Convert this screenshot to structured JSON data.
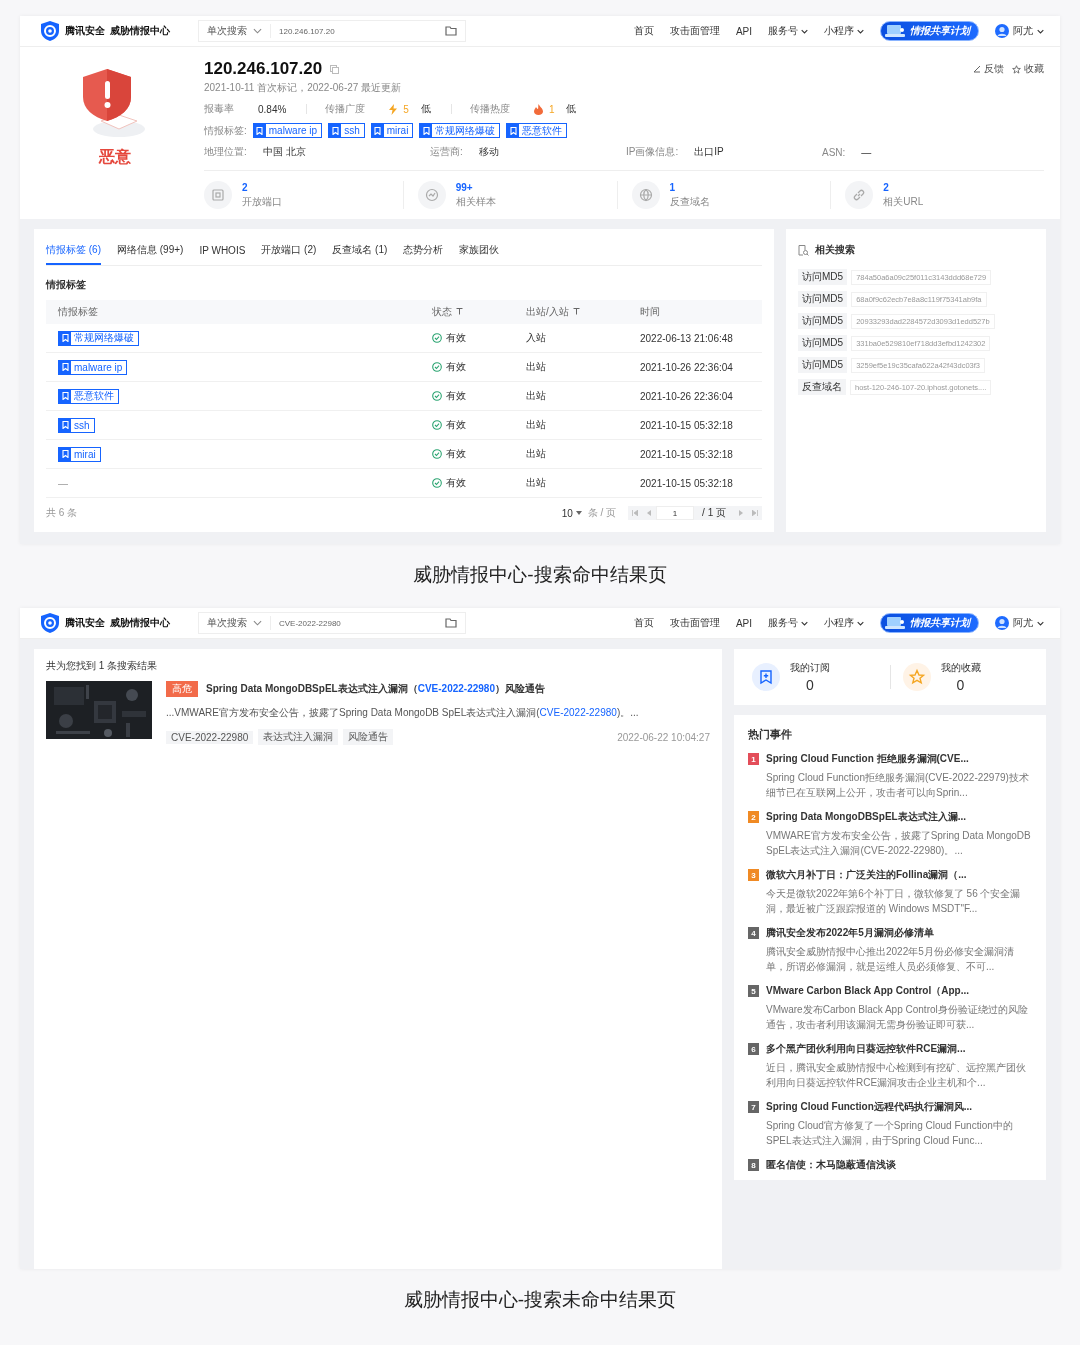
{
  "hit_page": {
    "header": {
      "brand": "腾讯安全",
      "product": "威胁情报中心",
      "search_mode": "单次搜索",
      "search_value": "120.246.107.20",
      "nav": [
        {
          "label": "首页",
          "has_menu": false
        },
        {
          "label": "攻击面管理",
          "has_menu": false
        },
        {
          "label": "API",
          "has_menu": false
        },
        {
          "label": "服务号",
          "has_menu": true
        },
        {
          "label": "小程序",
          "has_menu": true
        }
      ],
      "share_button": "情报共享计划",
      "user": "阿尤"
    },
    "verdict": "恶意",
    "ip": "120.246.107.20",
    "dates": "2021-10-11 首次标记，2022-06-27 最近更新",
    "actions": [
      {
        "label": "反馈",
        "kind": "edit"
      },
      {
        "label": "收藏",
        "kind": "star"
      }
    ],
    "stats": [
      {
        "label": "报毒率",
        "value": "0.84%",
        "kind": "plain"
      },
      {
        "label": "传播广度",
        "value": "5",
        "grade": "低",
        "kind": "bolt"
      },
      {
        "label": "传播热度",
        "value": "1",
        "grade": "低",
        "kind": "flame"
      }
    ],
    "tags_label": "情报标签:",
    "tags": [
      "malware ip",
      "ssh",
      "mirai",
      "常规网络爆破",
      "恶意软件"
    ],
    "info": [
      {
        "label": "地理位置:",
        "value": "中国 北京"
      },
      {
        "label": "运营商:",
        "value": "移动"
      },
      {
        "label": "IP画像信息:",
        "value": "出口IP"
      },
      {
        "label": "ASN:",
        "value": "—"
      }
    ],
    "counters": [
      {
        "value": "2",
        "label": "开放端口",
        "kind": "port"
      },
      {
        "value": "99+",
        "label": "相关样本",
        "kind": "sample"
      },
      {
        "value": "1",
        "label": "反查域名",
        "kind": "globe"
      },
      {
        "value": "2",
        "label": "相关URL",
        "kind": "link"
      }
    ],
    "tabs": [
      {
        "label": "情报标签 (6)",
        "selected": true
      },
      {
        "label": "网络信息 (99+)",
        "selected": false
      },
      {
        "label": "IP WHOIS",
        "selected": false
      },
      {
        "label": "开放端口 (2)",
        "selected": false
      },
      {
        "label": "反查域名 (1)",
        "selected": false
      },
      {
        "label": "态势分析",
        "selected": false
      },
      {
        "label": "家族团伙",
        "selected": false
      }
    ],
    "section_title": "情报标签",
    "columns": [
      {
        "label": "情报标签",
        "filter": false
      },
      {
        "label": "状态",
        "filter": true
      },
      {
        "label": "出站/入站",
        "filter": true
      },
      {
        "label": "时间",
        "filter": false
      }
    ],
    "rows": [
      {
        "kind": "tag",
        "tag": "常规网络爆破",
        "status": "有效",
        "direction": "入站",
        "time": "2022-06-13 21:06:48"
      },
      {
        "kind": "tag",
        "tag": "malware ip",
        "status": "有效",
        "direction": "出站",
        "time": "2021-10-26 22:36:04"
      },
      {
        "kind": "tag",
        "tag": "恶意软件",
        "status": "有效",
        "direction": "出站",
        "time": "2021-10-26 22:36:04"
      },
      {
        "kind": "tag",
        "tag": "ssh",
        "status": "有效",
        "direction": "出站",
        "time": "2021-10-15 05:32:18"
      },
      {
        "kind": "tag",
        "tag": "mirai",
        "status": "有效",
        "direction": "出站",
        "time": "2021-10-15 05:32:18"
      },
      {
        "kind": "plain",
        "tag": "—",
        "status": "有效",
        "direction": "出站",
        "time": "2021-10-15 05:32:18"
      }
    ],
    "pager": {
      "total": "共 6 条",
      "page_size": "10",
      "per_page": "条 / 页",
      "page": "1",
      "pages": "/ 1 页"
    },
    "related": {
      "title": "相关搜索",
      "items": [
        {
          "type": "访问MD5",
          "value": "784a50a6a09c25f011c3143ddd68e729"
        },
        {
          "type": "访问MD5",
          "value": "68a0f9c62ecb7e8a8c119f75341ab9fa"
        },
        {
          "type": "访问MD5",
          "value": "20933293dad2284572d3093d1edd527b"
        },
        {
          "type": "访问MD5",
          "value": "331ba0e529810ef718dd3efbd1242302"
        },
        {
          "type": "访问MD5",
          "value": "3259ef5e19c35cafa622a42f43dc03f3"
        },
        {
          "type": "反查域名",
          "value": "host-120-246-107-20.iphost.gotonets...."
        }
      ]
    },
    "caption": "威胁情报中心-搜索命中结果页"
  },
  "miss_page": {
    "header": {
      "brand": "腾讯安全",
      "product": "威胁情报中心",
      "search_mode": "单次搜索",
      "search_value": "CVE-2022-22980",
      "nav": [
        {
          "label": "首页",
          "has_menu": false
        },
        {
          "label": "攻击面管理",
          "has_menu": false
        },
        {
          "label": "API",
          "has_menu": false
        },
        {
          "label": "服务号",
          "has_menu": true
        },
        {
          "label": "小程序",
          "has_menu": true
        }
      ],
      "share_button": "情报共享计划",
      "user": "阿尤"
    },
    "result_count": "共为您找到 1 条搜索结果",
    "result": {
      "kind": "picture",
      "severity": "高危",
      "title_before": "Spring Data MongoDBSpEL表达式注入漏洞（",
      "title_link": "CVE-2022-22980",
      "title_after": "）风险通告",
      "summary_before": "...VMWARE官方发布安全公告，披露了Spring Data MongoDB SpEL表达式注入漏洞(",
      "summary_link": "CVE-2022-22980",
      "summary_after": ")。...",
      "tags": [
        "CVE-2022-22980",
        "表达式注入漏洞",
        "风险通告"
      ],
      "date": "2022-06-22 10:04:27"
    },
    "counters": [
      {
        "label": "我的订阅",
        "count": "0",
        "kind": "subscribe"
      },
      {
        "label": "我的收藏",
        "count": "0",
        "kind": "favorite"
      }
    ],
    "hot_title": "热门事件",
    "events": [
      {
        "rank": "1",
        "color": "#e34d59",
        "title": "Spring Cloud Function 拒绝服务漏洞(CVE...",
        "summary": "Spring Cloud Function拒绝服务漏洞(CVE-2022-22979)技术细节已在互联网上公开，攻击者可以向Sprin..."
      },
      {
        "rank": "2",
        "color": "#f08a24",
        "title": "Spring Data MongoDBSpEL表达式注入漏...",
        "summary": "VMWARE官方发布安全公告，披露了Spring Data MongoDB SpEL表达式注入漏洞(CVE-2022-22980)。..."
      },
      {
        "rank": "3",
        "color": "#f08a24",
        "title": "微软六月补丁日：广泛关注的Follina漏洞（...",
        "summary": "今天是微软2022年第6个补丁日，微软修复了 56 个安全漏洞，最近被广泛跟踪报道的 Windows MSDT\"F..."
      },
      {
        "rank": "4",
        "color": "#666666",
        "title": "腾讯安全发布2022年5月漏洞必修清单",
        "summary": "腾讯安全威胁情报中心推出2022年5月份必修安全漏洞清单，所谓必修漏洞，就是运维人员必须修复、不可..."
      },
      {
        "rank": "5",
        "color": "#666666",
        "title": "VMware Carbon Black App Control（App...",
        "summary": "VMware发布Carbon Black App Control身份验证绕过的风险通告，攻击者利用该漏洞无需身份验证即可获..."
      },
      {
        "rank": "6",
        "color": "#666666",
        "title": "多个黑产团伙利用向日葵远控软件RCE漏洞...",
        "summary": "近日，腾讯安全威胁情报中心检测到有挖矿、远控黑产团伙利用向日葵远控软件RCE漏洞攻击企业主机和个..."
      },
      {
        "rank": "7",
        "color": "#666666",
        "title": "Spring Cloud Function远程代码执行漏洞风...",
        "summary": "Spring Cloud官方修复了一个Spring Cloud Function中的SPEL表达式注入漏洞，由于Spring Cloud Func..."
      },
      {
        "rank": "8",
        "color": "#666666",
        "title": "匿名信使：木马隐蔽通信浅谈"
      }
    ],
    "caption": "威胁情报中心-搜索未命中结果页"
  }
}
